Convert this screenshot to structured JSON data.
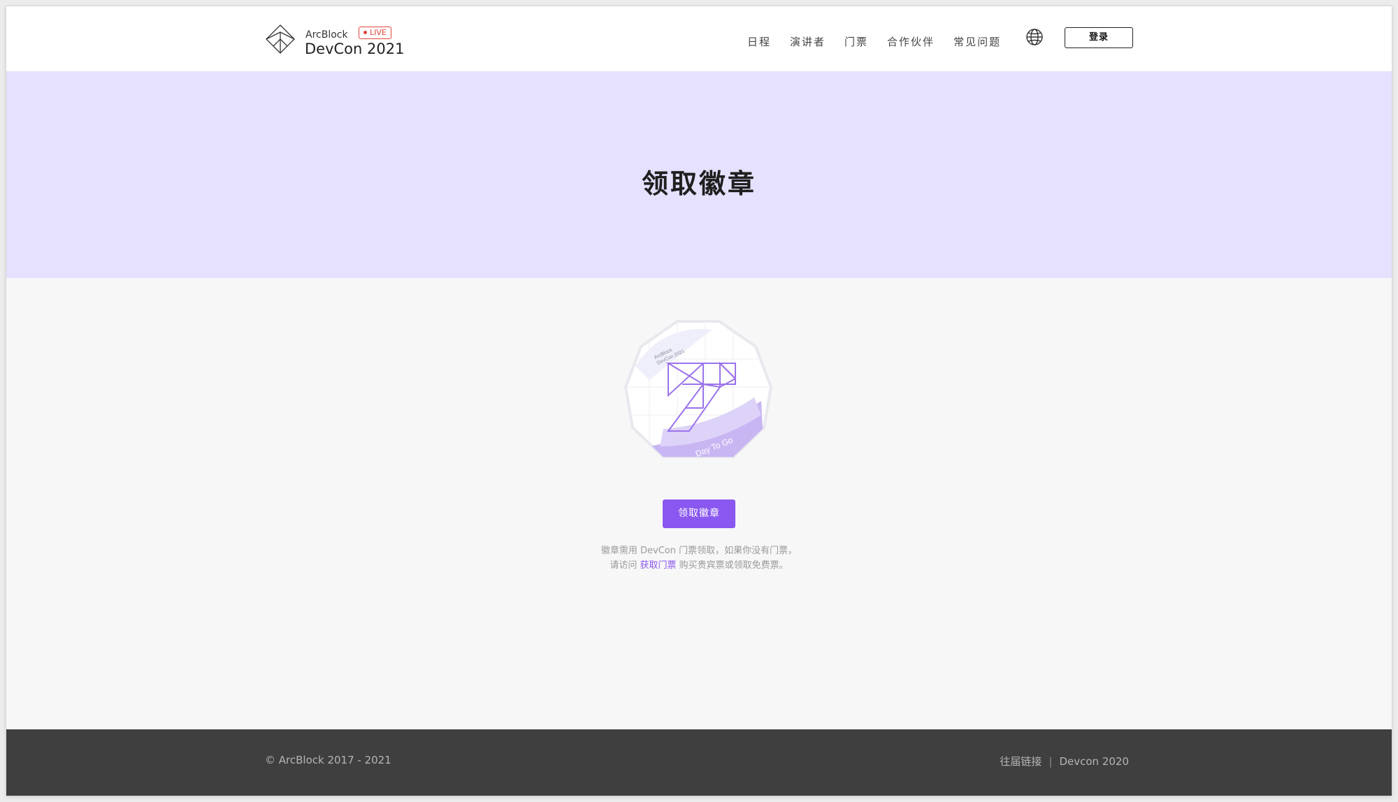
{
  "header": {
    "brand_company": "ArcBlock",
    "brand_live": "LIVE",
    "brand_title": "DevCon 2021",
    "nav": [
      "日程",
      "演讲者",
      "门票",
      "合作伙伴",
      "常见问题"
    ],
    "login_label": "登录"
  },
  "hero": {
    "title": "领取徽章"
  },
  "badge": {
    "small_text_1": "ArcBlock",
    "small_text_2": "DevCon 2021",
    "ribbon_text": "Day To Go"
  },
  "main": {
    "claim_button": "领取徽章",
    "note_line1": "徽章需用 DevCon 门票领取，如果你没有门票，",
    "note_line2_prefix": "请访问 ",
    "note_link": "获取门票",
    "note_line2_suffix": " 购买贵宾票或领取免费票。"
  },
  "footer": {
    "copyright": "© ArcBlock 2017 - 2021",
    "past_links_label": "往届链接",
    "separator": "|",
    "devcon_2020": "Devcon 2020"
  },
  "colors": {
    "accent": "#8a57f0",
    "hero_bg": "#e5e1fe",
    "footer_bg": "#3f3f3f",
    "live_red": "#e0453a"
  },
  "icons": [
    "arcblock-logo-icon",
    "live-dot-icon",
    "globe-icon",
    "badge-seven-icon"
  ]
}
